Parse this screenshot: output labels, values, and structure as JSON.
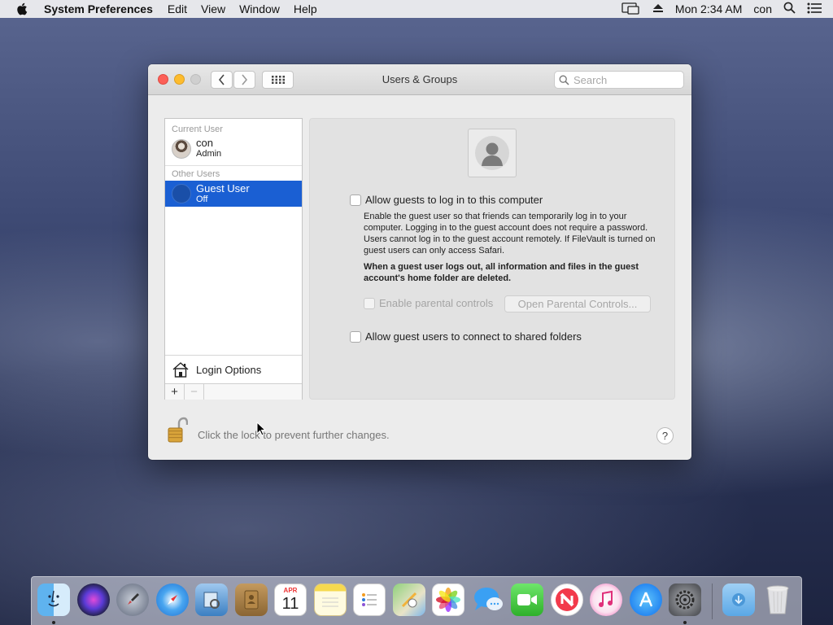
{
  "menubar": {
    "app_name": "System Preferences",
    "menus": [
      "Edit",
      "View",
      "Window",
      "Help"
    ],
    "clock": "Mon 2:34 AM",
    "user": "con"
  },
  "window": {
    "title": "Users & Groups",
    "search_placeholder": "Search"
  },
  "user_list": {
    "current_user_header": "Current User",
    "current_user": {
      "name": "con",
      "role": "Admin"
    },
    "other_users_header": "Other Users",
    "guest_user": {
      "name": "Guest User",
      "status": "Off"
    },
    "login_options": "Login Options",
    "add_label": "+",
    "remove_label": "−"
  },
  "guest_pane": {
    "allow_login_label": "Allow guests to log in to this computer",
    "description": "Enable the guest user so that friends can temporarily log in to your computer. Logging in to the guest account does not require a password. Users cannot log in to the guest account remotely. If FileVault is turned on guest users can only access Safari.",
    "warning": "When a guest user logs out, all information and files in the guest account's home folder are deleted.",
    "parental_controls_label": "Enable parental controls",
    "open_parental_button": "Open Parental Controls...",
    "shared_folders_label": "Allow guest users to connect to shared folders"
  },
  "footer": {
    "lock_text": "Click the lock to prevent further changes.",
    "help_label": "?"
  },
  "dock": {
    "calendar_month": "APR",
    "calendar_day": "11"
  }
}
